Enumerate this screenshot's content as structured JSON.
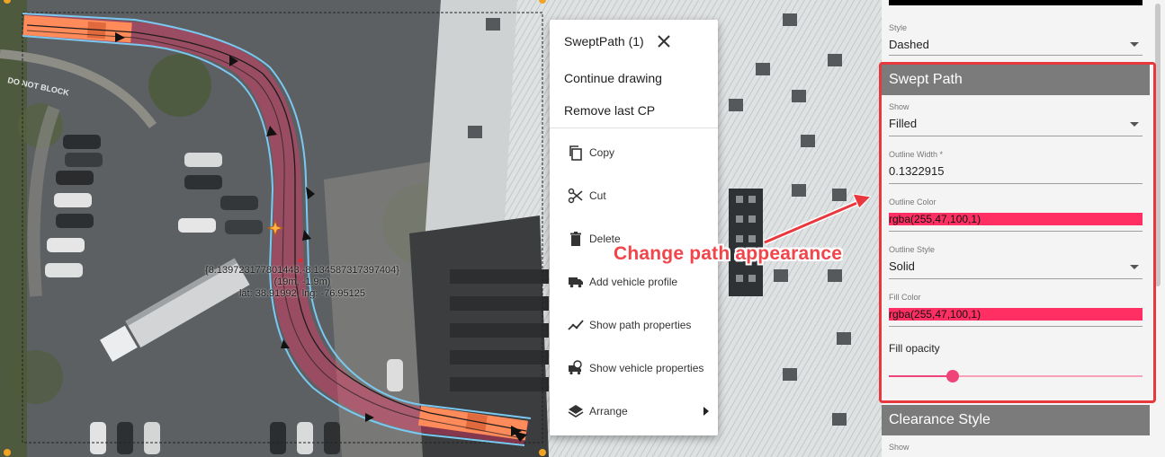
{
  "map": {
    "coordinates": "{8.139723177801443,-8.134587317397404}",
    "offset": "(19m, -1.9m)",
    "latlng": "lat: 38.91992, lng: -76.95125"
  },
  "context_menu": {
    "title": "SweptPath (1)",
    "continue_drawing": "Continue drawing",
    "remove_last_cp": "Remove last CP",
    "items": [
      {
        "label": "Copy",
        "icon": "copy-icon"
      },
      {
        "label": "Cut",
        "icon": "scissors-icon"
      },
      {
        "label": "Delete",
        "icon": "trash-icon"
      },
      {
        "label": "Add vehicle profile",
        "icon": "truck-icon"
      },
      {
        "label": "Show path properties",
        "icon": "path-icon"
      },
      {
        "label": "Show vehicle properties",
        "icon": "vehicle-settings-icon"
      },
      {
        "label": "Arrange",
        "icon": "layers-icon"
      }
    ]
  },
  "panel": {
    "style_label": "Style",
    "style_value": "Dashed",
    "swept_path": {
      "header": "Swept Path",
      "show_label": "Show",
      "show_value": "Filled",
      "outline_width_label": "Outline Width *",
      "outline_width_value": "0.1322915",
      "outline_color_label": "Outline Color",
      "outline_color_value": "rgba(255,47,100,1)",
      "outline_style_label": "Outline Style",
      "outline_style_value": "Solid",
      "fill_color_label": "Fill Color",
      "fill_color_value": "rgba(255,47,100,1)",
      "fill_opacity_label": "Fill opacity",
      "fill_opacity": 0.25
    },
    "clearance_style": {
      "header": "Clearance Style",
      "show_label": "Show"
    }
  },
  "annotation": {
    "text": "Change path appearance"
  },
  "colors": {
    "accent": "#f0437a",
    "swept_color": "#ff2f64",
    "annotation": "#e8383d"
  }
}
